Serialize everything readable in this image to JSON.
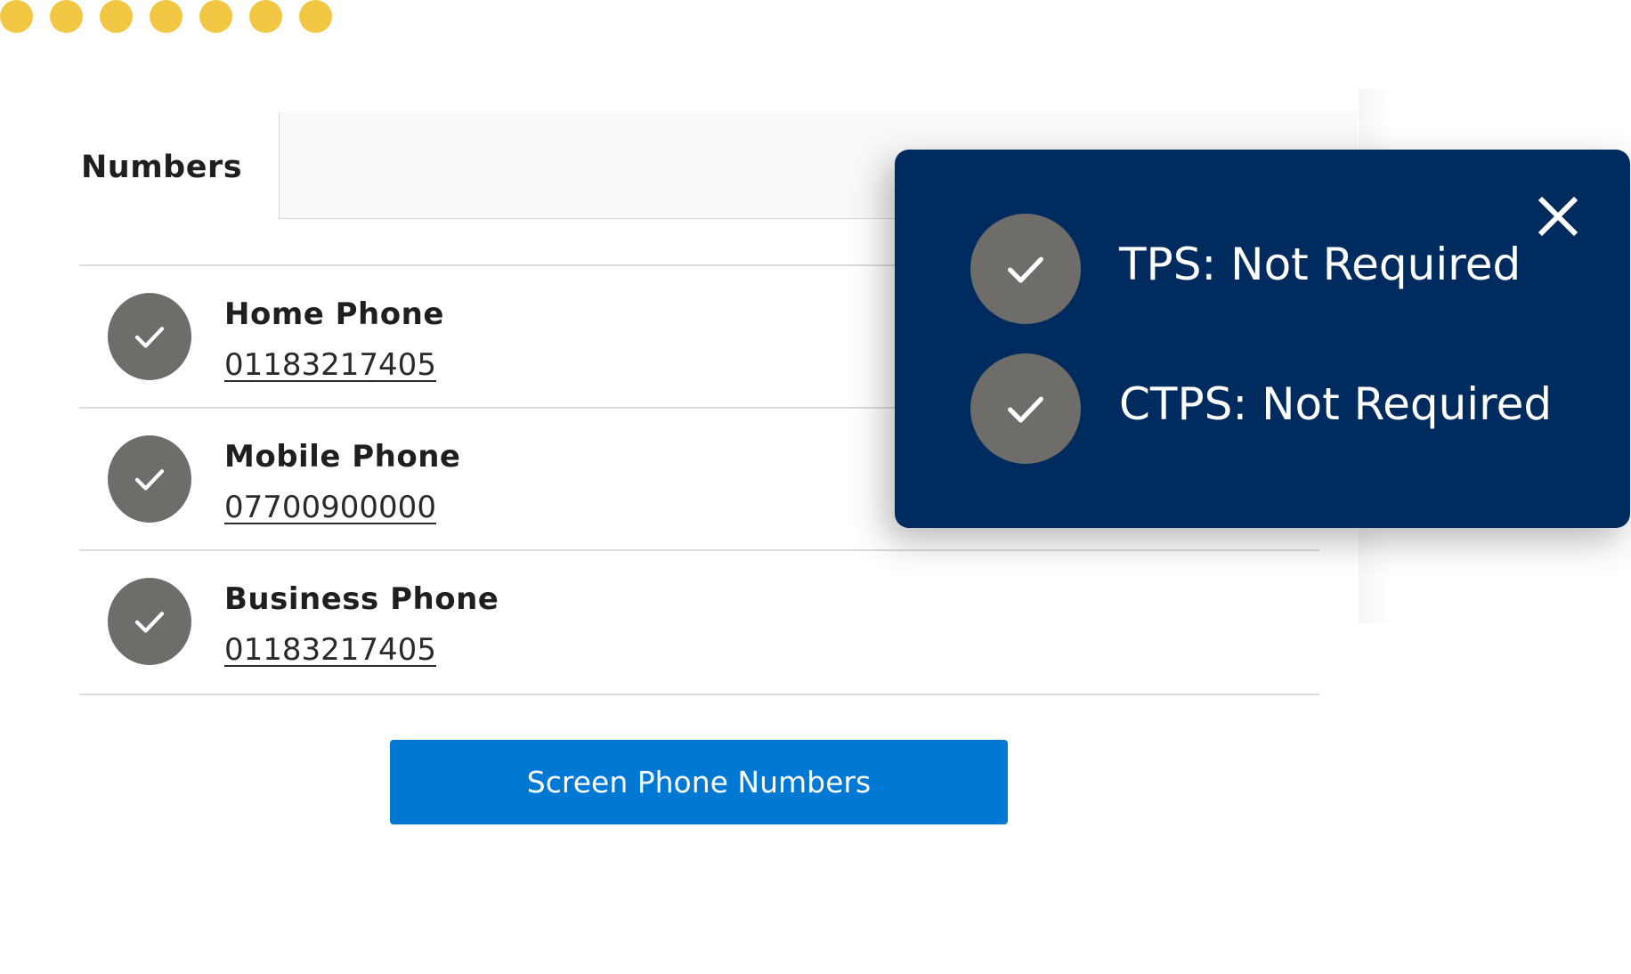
{
  "colors": {
    "dot": "#f2c744",
    "check_badge": "#6f6d69",
    "popup_background": "#002b5e",
    "button_background": "#0078d4"
  },
  "decorative_dots_count": 7,
  "form": {
    "numbers_label": "Numbers",
    "numbers_input_value": ""
  },
  "phones": [
    {
      "label": "Home Phone",
      "number": "01183217405",
      "status_icon": "check-icon"
    },
    {
      "label": "Mobile Phone",
      "number": "07700900000",
      "status_icon": "check-icon"
    },
    {
      "label": "Business Phone",
      "number": "01183217405",
      "status_icon": "check-icon"
    }
  ],
  "actions": {
    "screen_label": "Screen Phone Numbers"
  },
  "popup": {
    "close_icon": "close-icon",
    "items": [
      {
        "text": "TPS: Not Required",
        "icon": "check-icon"
      },
      {
        "text": "CTPS: Not Required",
        "icon": "check-icon"
      }
    ]
  }
}
